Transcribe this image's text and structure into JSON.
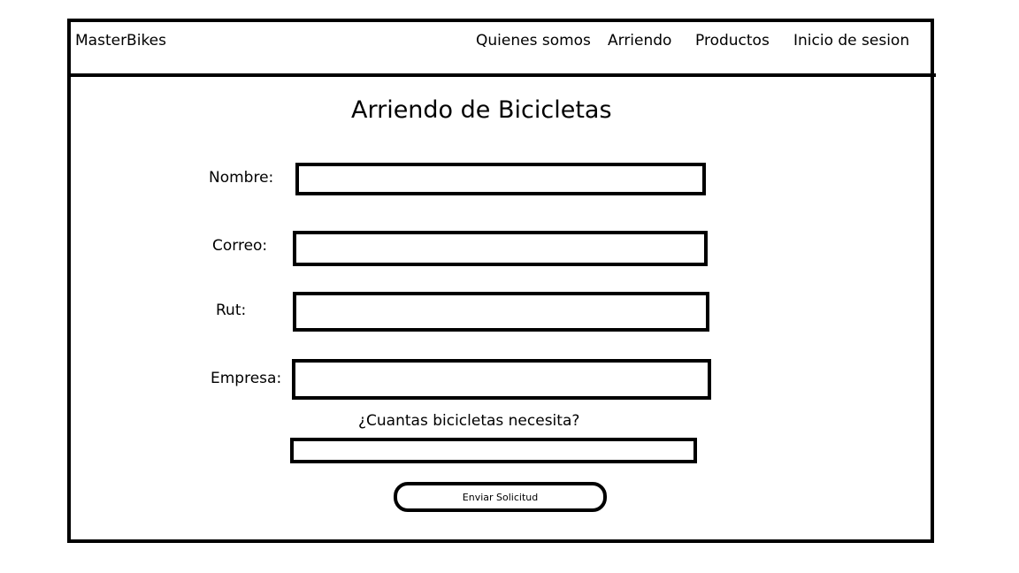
{
  "header": {
    "brand": "MasterBikes",
    "nav": {
      "quienes_somos": "Quienes somos",
      "arriendo": "Arriendo",
      "productos": "Productos",
      "inicio_sesion": "Inicio de sesion"
    }
  },
  "main": {
    "title": "Arriendo de Bicicletas",
    "form": {
      "nombre_label": "Nombre:",
      "nombre_value": "",
      "correo_label": "Correo:",
      "correo_value": "",
      "rut_label": "Rut:",
      "rut_value": "",
      "empresa_label": "Empresa:",
      "empresa_value": "",
      "cantidad_question": "¿Cuantas bicicletas necesita?",
      "cantidad_value": "",
      "submit_label": "Enviar Solicitud"
    }
  }
}
